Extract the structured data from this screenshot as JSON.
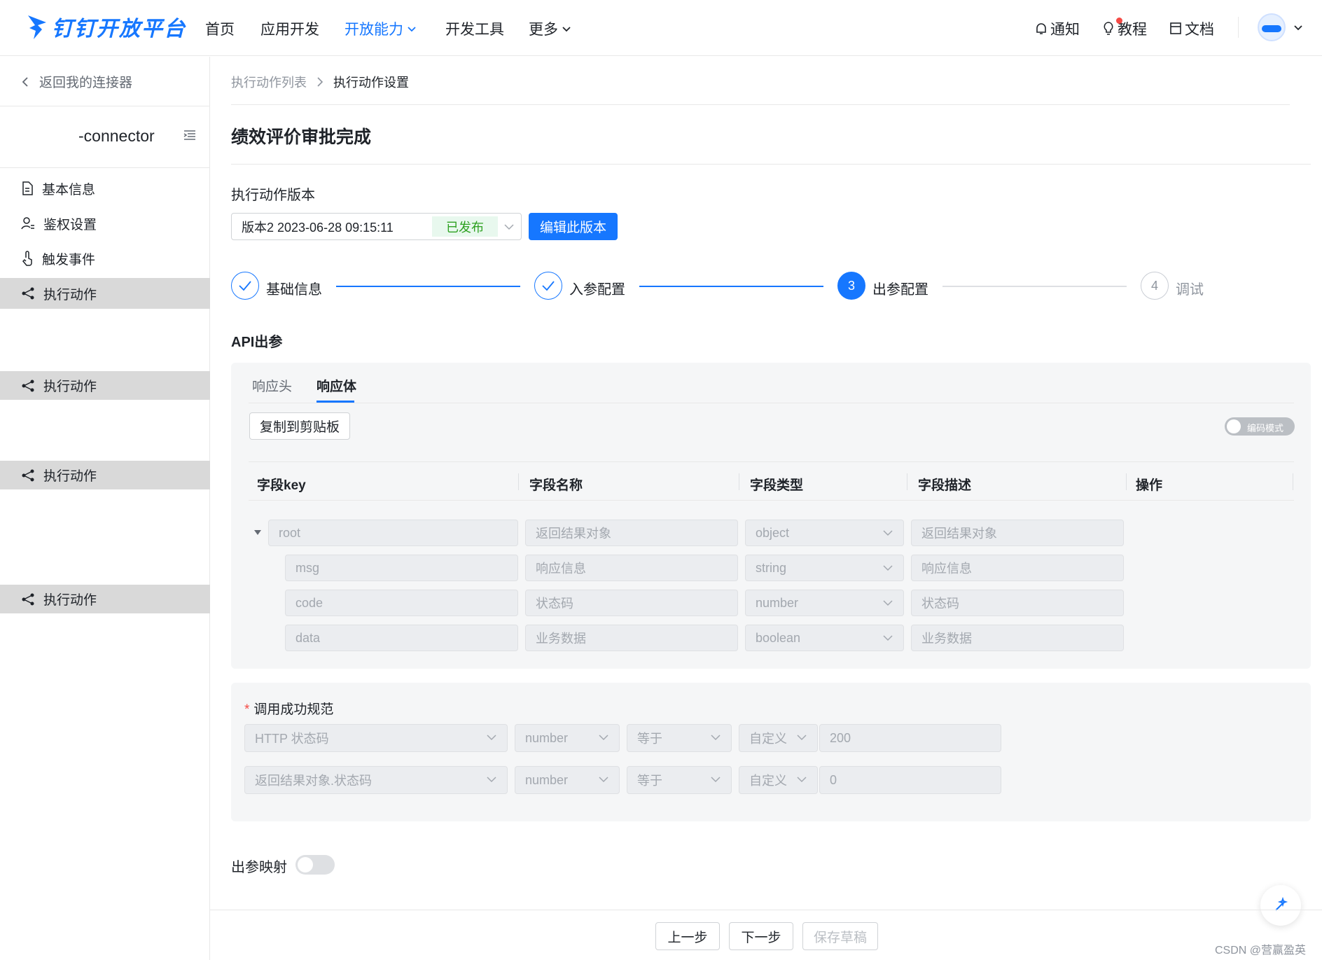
{
  "brand": {
    "name": "钉钉开放平台",
    "accent": "#1677ff"
  },
  "nav": {
    "items": [
      {
        "label": "首页"
      },
      {
        "label": "应用开发"
      },
      {
        "label": "开放能力"
      },
      {
        "label": "开发工具"
      },
      {
        "label": "更多"
      }
    ],
    "right": {
      "notify": "通知",
      "tutorial": "教程",
      "docs": "文档"
    }
  },
  "sidebar": {
    "back": "返回我的连接器",
    "connector_name": "-connector",
    "items": [
      {
        "label": "基本信息",
        "icon": "document-icon"
      },
      {
        "label": "鉴权设置",
        "icon": "user-key-icon"
      },
      {
        "label": "触发事件",
        "icon": "touch-icon"
      },
      {
        "label": "执行动作",
        "icon": "share-icon"
      },
      {
        "label": "执行动作",
        "icon": "share-icon"
      },
      {
        "label": "执行动作",
        "icon": "share-icon"
      },
      {
        "label": "执行动作",
        "icon": "share-icon"
      }
    ]
  },
  "breadcrumb": {
    "parent": "执行动作列表",
    "current": "执行动作设置"
  },
  "page_title": "绩效评价审批完成",
  "version": {
    "label": "执行动作版本",
    "value": "版本2 2023-06-28 09:15:11",
    "status": "已发布",
    "edit_button": "编辑此版本"
  },
  "steps": [
    {
      "num": "1",
      "label": "基础信息",
      "state": "done"
    },
    {
      "num": "2",
      "label": "入参配置",
      "state": "done"
    },
    {
      "num": "3",
      "label": "出参配置",
      "state": "current"
    },
    {
      "num": "4",
      "label": "调试",
      "state": "pending"
    }
  ],
  "api_out": {
    "title": "API出参",
    "tabs": [
      "响应头",
      "响应体"
    ],
    "active_tab": "响应体",
    "copy_button": "复制到剪贴板",
    "code_mode": "编码模式",
    "columns": [
      "字段key",
      "字段名称",
      "字段类型",
      "字段描述",
      "操作"
    ],
    "rows": [
      {
        "key": "root",
        "name": "返回结果对象",
        "type": "object",
        "desc": "返回结果对象"
      },
      {
        "key": "msg",
        "name": "响应信息",
        "type": "string",
        "desc": "响应信息"
      },
      {
        "key": "code",
        "name": "状态码",
        "type": "number",
        "desc": "状态码"
      },
      {
        "key": "data",
        "name": "业务数据",
        "type": "boolean",
        "desc": "业务数据"
      }
    ]
  },
  "success_rule": {
    "title": "调用成功规范",
    "rows": [
      {
        "source": "HTTP 状态码",
        "type": "number",
        "op": "等于",
        "mode": "自定义",
        "value": "200"
      },
      {
        "source": "返回结果对象.状态码",
        "type": "number",
        "op": "等于",
        "mode": "自定义",
        "value": "0"
      }
    ]
  },
  "mapping": {
    "label": "出参映射"
  },
  "footer": {
    "prev": "上一步",
    "next": "下一步",
    "save": "保存草稿"
  },
  "watermark": "CSDN @营赢盈英"
}
